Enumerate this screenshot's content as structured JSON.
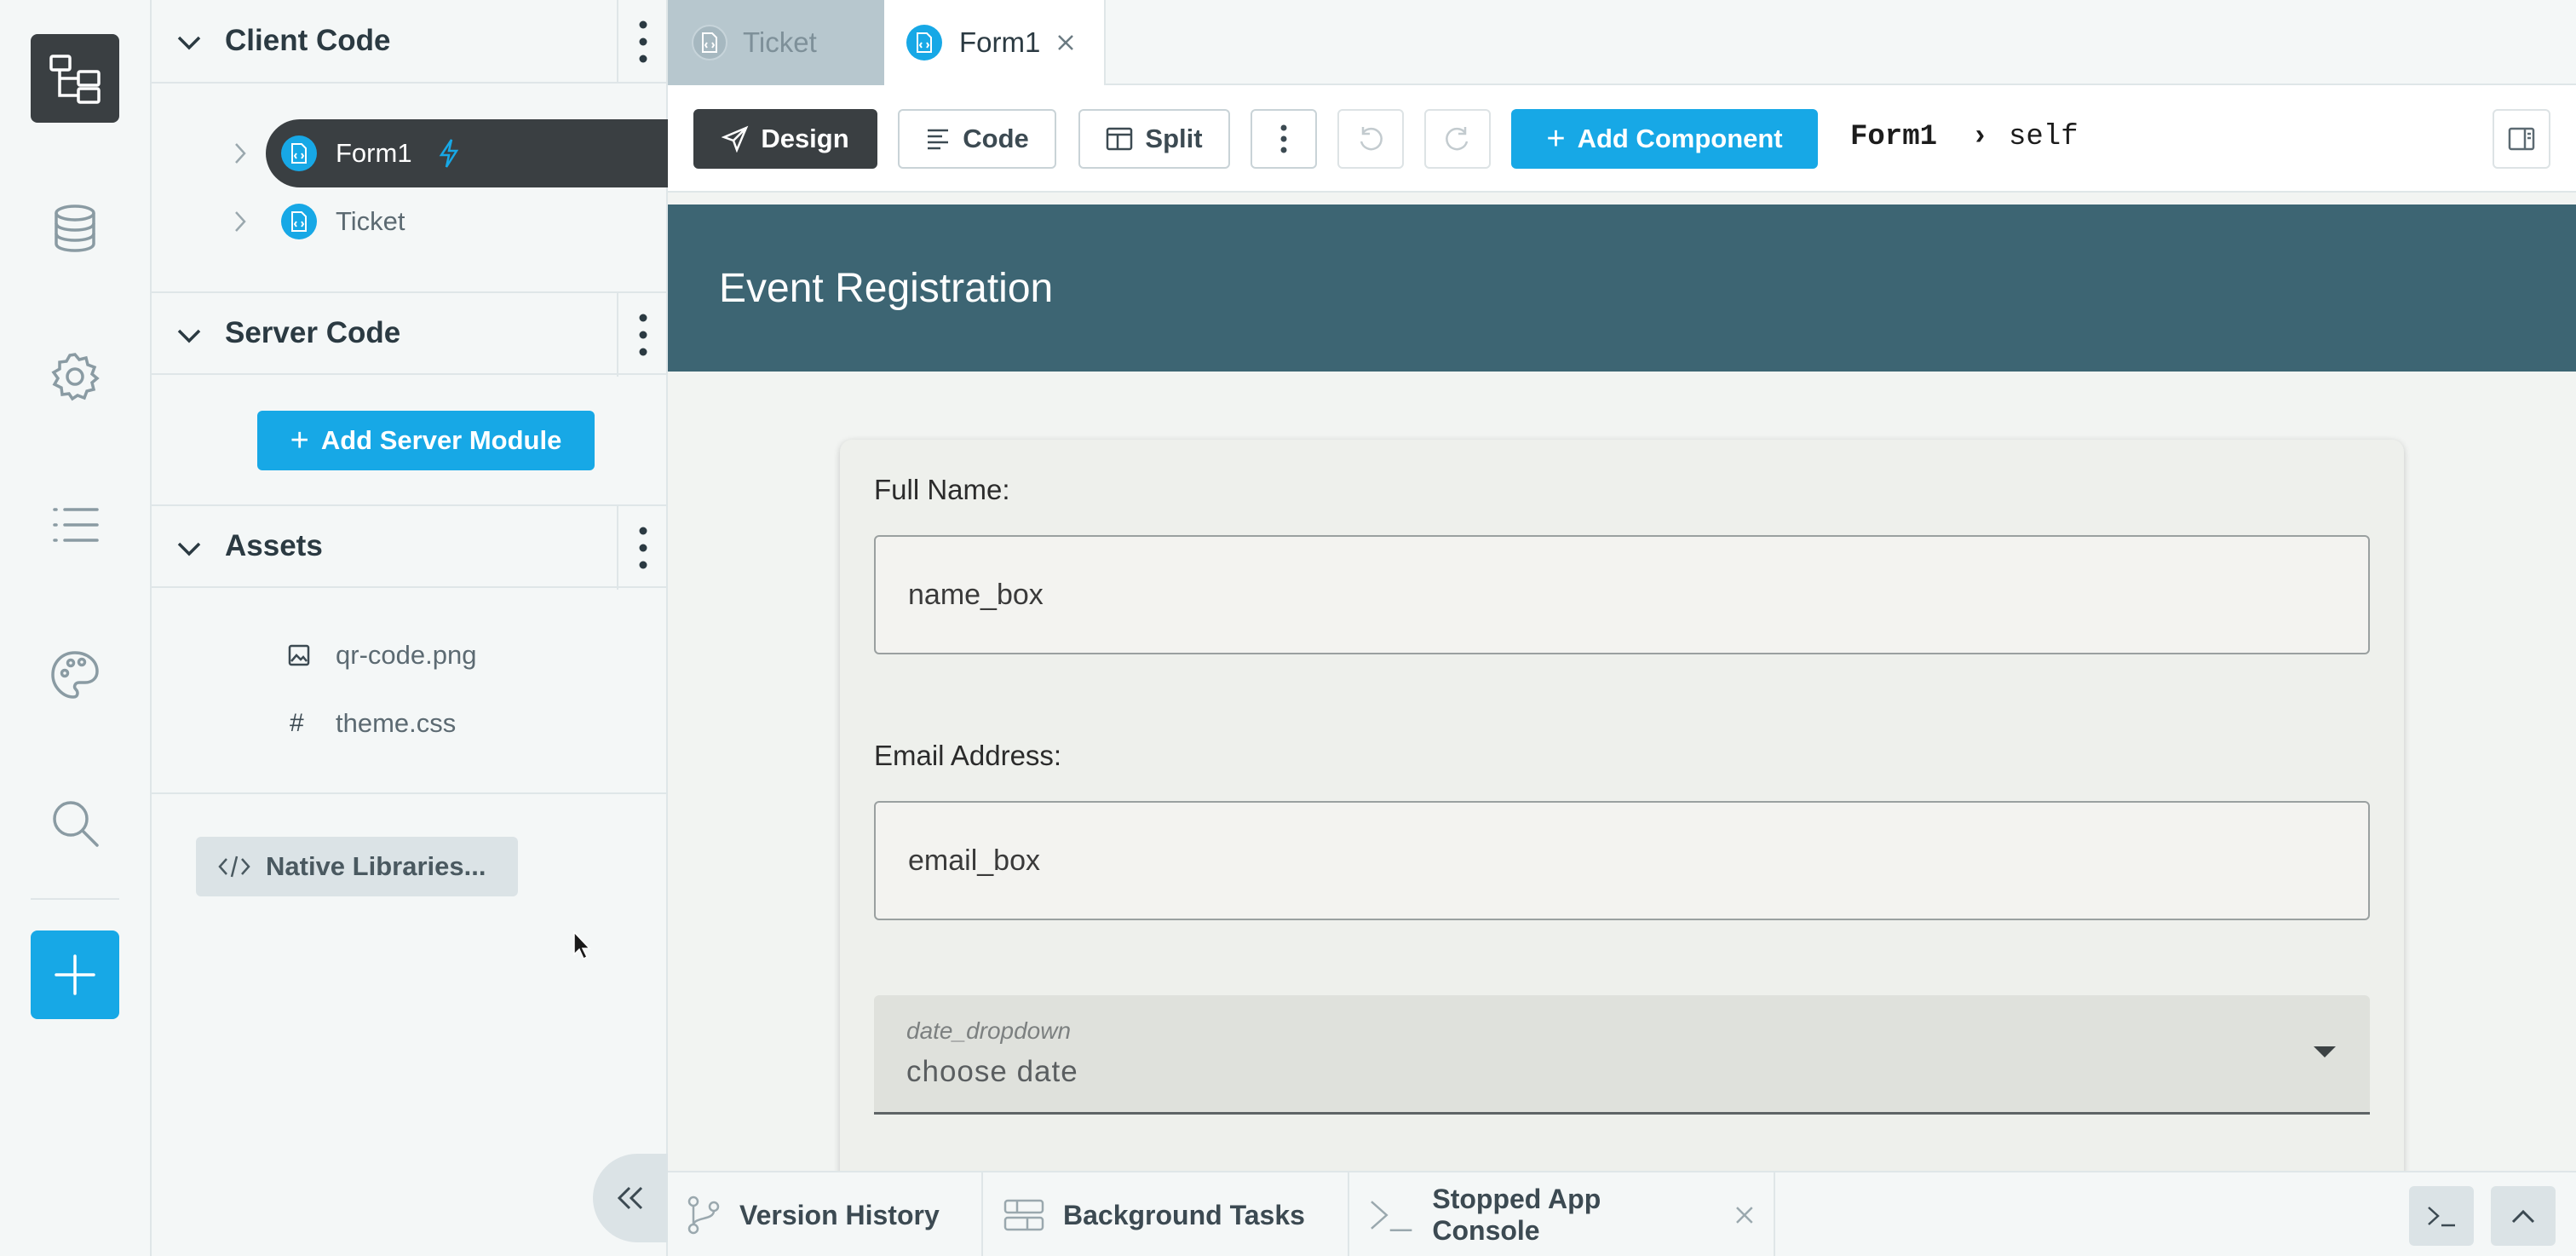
{
  "rail": {
    "items": [
      "app-browser-icon",
      "database-icon",
      "gear-icon",
      "list-icon",
      "palette-icon",
      "search-icon",
      "plus-icon"
    ]
  },
  "client_code": {
    "title": "Client Code",
    "items": [
      {
        "label": "Form1",
        "icon": "form-icon",
        "badge": "lightning-icon",
        "selected": true
      },
      {
        "label": "Ticket",
        "icon": "form-icon",
        "selected": false
      }
    ]
  },
  "server_code": {
    "title": "Server Code",
    "add_button": "Add Server Module"
  },
  "assets": {
    "title": "Assets",
    "items": [
      {
        "label": "qr-code.png",
        "icon": "image-icon"
      },
      {
        "label": "theme.css",
        "icon": "#"
      }
    ]
  },
  "native_libraries": {
    "label": "Native Libraries..."
  },
  "tabs": [
    {
      "label": "Ticket",
      "active": false
    },
    {
      "label": "Form1",
      "active": true,
      "closable": true
    }
  ],
  "toolbar": {
    "design": "Design",
    "code": "Code",
    "split": "Split",
    "add_component": "Add Component",
    "breadcrumb_form": "Form1",
    "breadcrumb_sep": "›",
    "breadcrumb_self": "self"
  },
  "form": {
    "header_title": "Event Registration",
    "full_name_label": "Full Name:",
    "name_box": "name_box",
    "email_label": "Email Address:",
    "email_box": "email_box",
    "dropdown_label": "date_dropdown",
    "dropdown_value": "choose date"
  },
  "bottom": {
    "version_history": "Version History",
    "background_tasks": "Background Tasks",
    "console": "Stopped App Console"
  },
  "colors": {
    "accent": "#17a8e6",
    "dark": "#3a3f42",
    "header": "#3d6573"
  }
}
